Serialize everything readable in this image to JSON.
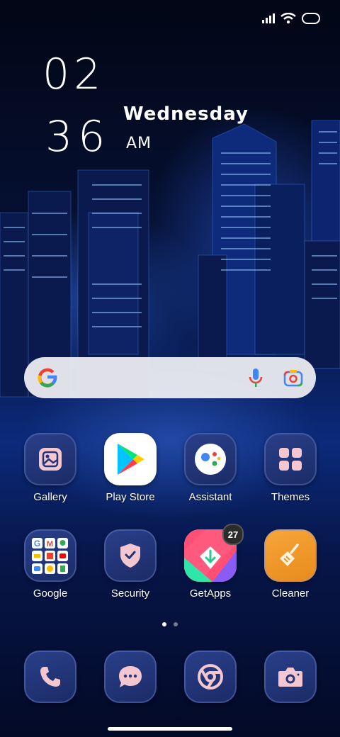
{
  "status": {
    "icons": [
      "signal-icon",
      "wifi-icon",
      "battery-icon"
    ]
  },
  "clock": {
    "hour": "02",
    "minute": "36",
    "weekday": "Wednesday",
    "ampm": "AM"
  },
  "search": {
    "icons": [
      "google-g-icon",
      "microphone-icon",
      "lens-camera-icon"
    ]
  },
  "apps": {
    "gallery": {
      "label": "Gallery"
    },
    "playstore": {
      "label": "Play Store"
    },
    "assistant": {
      "label": "Assistant"
    },
    "themes": {
      "label": "Themes"
    },
    "google": {
      "label": "Google"
    },
    "security": {
      "label": "Security"
    },
    "getapps": {
      "label": "GetApps",
      "badge": "27"
    },
    "cleaner": {
      "label": "Cleaner"
    }
  },
  "page_indicator": {
    "total": 2,
    "active": 1
  },
  "dock": [
    "phone-icon",
    "messages-icon",
    "chrome-icon",
    "camera-icon"
  ],
  "colors": {
    "accent_pink": "#f4c6cf",
    "tile_blue": "#22357a",
    "cleaner_orange": "#f29a2a"
  }
}
